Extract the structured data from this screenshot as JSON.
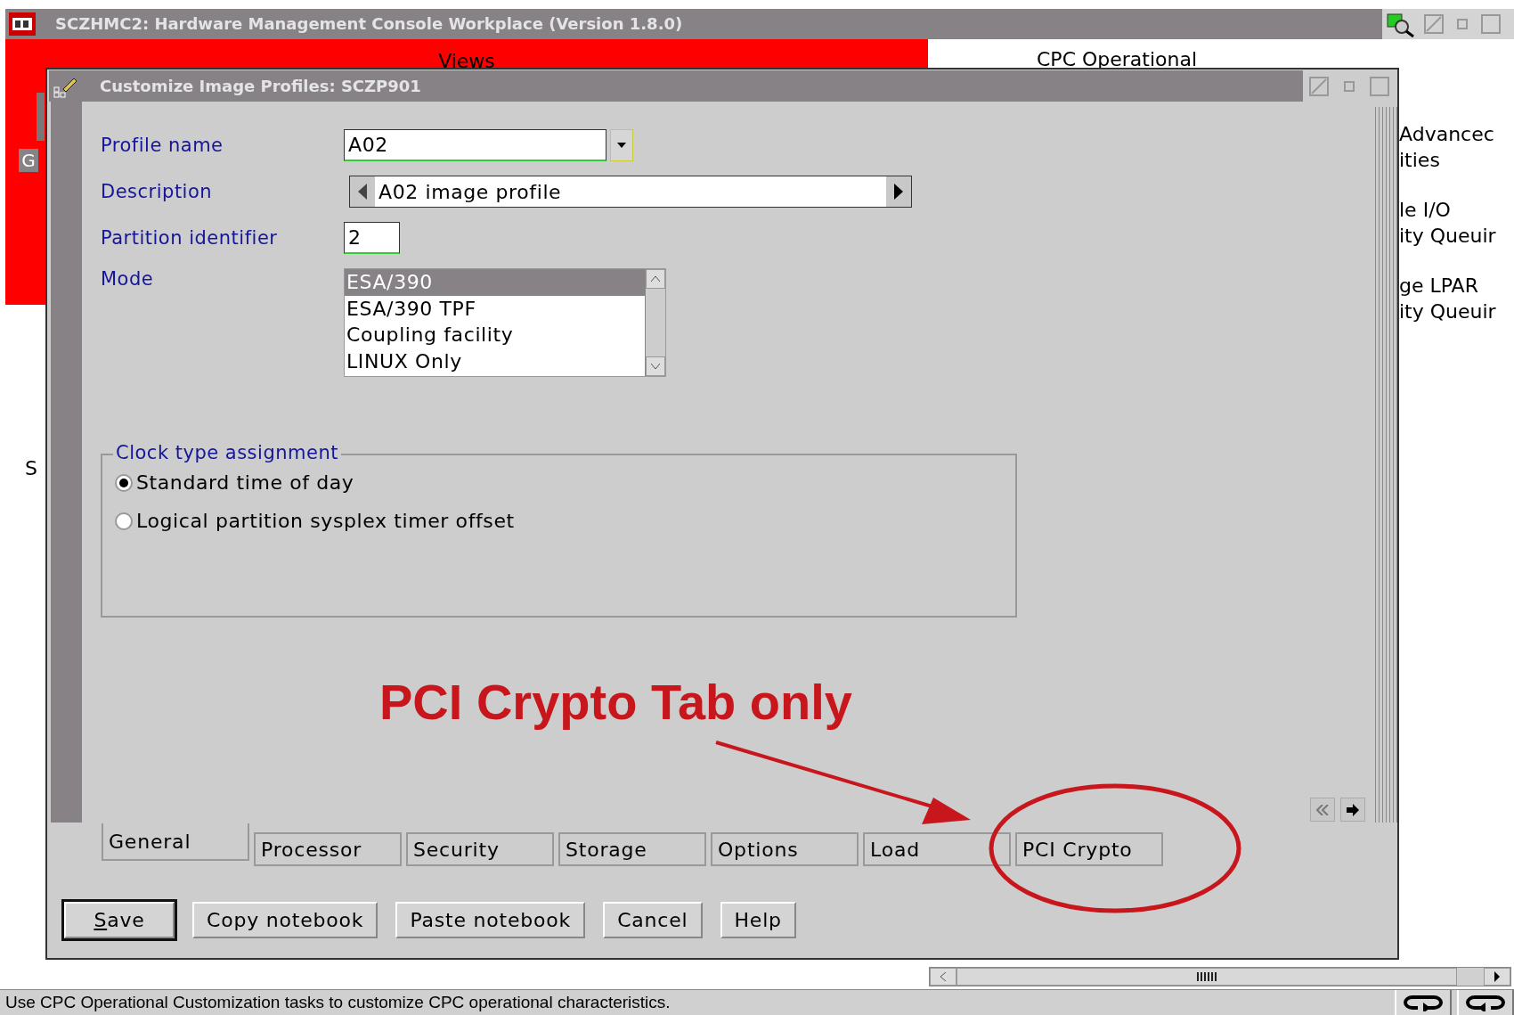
{
  "app_window": {
    "title": "SCZHMC2: Hardware Management Console Workplace (Version 1.8.0)"
  },
  "background": {
    "views_title": "Views",
    "views_button": "G",
    "side_text": "S",
    "right_title": "CPC Operational",
    "right_lines": [
      "Advancec",
      "ities",
      "le I/O",
      "ity Queuir",
      "ge LPAR",
      "ity Queuir"
    ]
  },
  "dialog": {
    "title": "Customize Image Profiles: SCZP901",
    "fields": [
      {
        "kind": "combo",
        "label": "Profile name",
        "value": "A02"
      },
      {
        "kind": "spin",
        "label": "Description",
        "value": "A02 image profile"
      },
      {
        "kind": "text",
        "label": "Partition identifier",
        "value": "2"
      },
      {
        "kind": "list",
        "label": "Mode",
        "options": [
          {
            "label": "ESA/390",
            "selected": true
          },
          {
            "label": "ESA/390 TPF",
            "selected": false
          },
          {
            "label": "Coupling facility",
            "selected": false
          },
          {
            "label": "LINUX Only",
            "selected": false
          }
        ]
      }
    ],
    "clock_group": {
      "title": "Clock type assignment",
      "options": [
        {
          "label": "Standard time of day",
          "selected": true
        },
        {
          "label": "Logical partition sysplex timer offset",
          "selected": false
        }
      ]
    },
    "tabs": [
      {
        "label": "General",
        "selected": true
      },
      {
        "label": "Processor",
        "selected": false
      },
      {
        "label": "Security",
        "selected": false
      },
      {
        "label": "Storage",
        "selected": false
      },
      {
        "label": "Options",
        "selected": false
      },
      {
        "label": "Load",
        "selected": false
      },
      {
        "label": "PCI Crypto",
        "selected": false
      }
    ],
    "buttons": [
      {
        "label": "Save",
        "default": true,
        "mnemonic": true
      },
      {
        "label": "Copy notebook",
        "default": false,
        "mnemonic": false
      },
      {
        "label": "Paste notebook",
        "default": false,
        "mnemonic": false
      },
      {
        "label": "Cancel",
        "default": false,
        "mnemonic": false
      },
      {
        "label": "Help",
        "default": false,
        "mnemonic": false
      }
    ]
  },
  "annotation": {
    "text": "PCI Crypto Tab only"
  },
  "status_bar": {
    "text": "Use CPC Operational Customization tasks to customize CPC operational characteristics."
  }
}
